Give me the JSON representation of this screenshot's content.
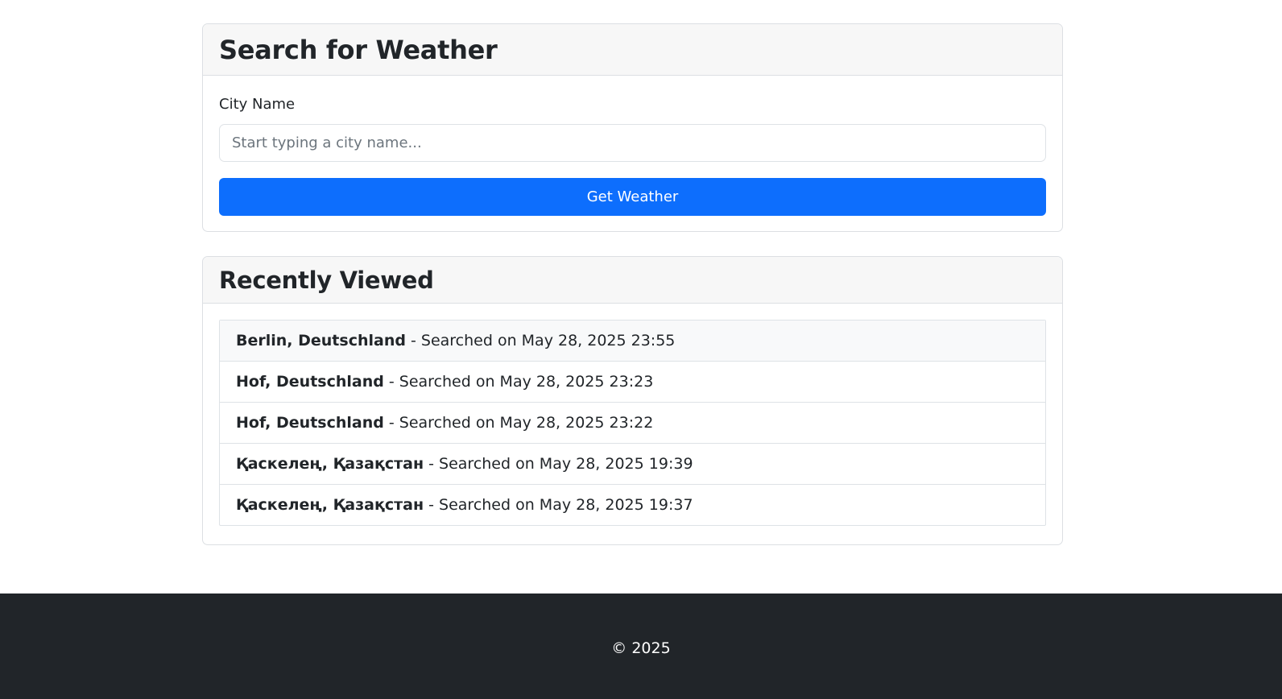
{
  "search": {
    "title": "Search for Weather",
    "field_label": "City Name",
    "placeholder": "Start typing a city name...",
    "value": "",
    "button_label": "Get Weather"
  },
  "recent": {
    "title": "Recently Viewed",
    "separator": " - ",
    "items": [
      {
        "city": "Berlin, Deutschland",
        "text": "Searched on May 28, 2025 23:55"
      },
      {
        "city": "Hof, Deutschland",
        "text": "Searched on May 28, 2025 23:23"
      },
      {
        "city": "Hof, Deutschland",
        "text": "Searched on May 28, 2025 23:22"
      },
      {
        "city": "Қаскелең, Қазақстан",
        "text": "Searched on May 28, 2025 19:39"
      },
      {
        "city": "Қаскелең, Қазақстан",
        "text": "Searched on May 28, 2025 19:37"
      }
    ]
  },
  "footer": {
    "copyright": "© 2025"
  },
  "colors": {
    "primary": "#0d6efd",
    "footer_bg": "#212529",
    "header_bg": "#f7f7f7"
  }
}
